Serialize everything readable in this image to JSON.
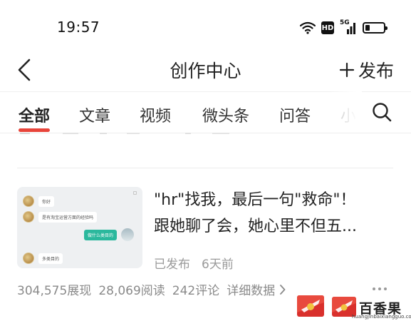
{
  "status_bar": {
    "time": "19:57",
    "network_label": "5G",
    "hd_label": "HD",
    "battery_level": 0.25
  },
  "nav": {
    "title": "创作中心",
    "publish_label": "发布",
    "back_icon": "chevron-left-icon",
    "publish_icon": "plus-icon"
  },
  "tabs": [
    {
      "label": "全部",
      "active": true
    },
    {
      "label": "文章",
      "active": false
    },
    {
      "label": "视频",
      "active": false
    },
    {
      "label": "微头条",
      "active": false
    },
    {
      "label": "问答",
      "active": false
    },
    {
      "label": "小",
      "active": false
    }
  ],
  "accent_color": "#e8443a",
  "article": {
    "title_line1": "\"hr\"找我，最后一句\"救命\"！",
    "title_line2": "跟她聊了会，她心里不但五...",
    "status": "已发布",
    "time": "6天前",
    "thumbnail": {
      "msg1": "你好",
      "msg2": "是有淘宝运营方面的经验吗",
      "msg3": "做什么类目的",
      "msg4": "多类目的"
    },
    "stats": {
      "views": "304,575展现",
      "reads": "28,069阅读",
      "comments": "242评论",
      "detail_label": "详细数据"
    }
  },
  "watermark": {
    "text": "百香果号",
    "url": "huangjinbaixiangguo.com"
  }
}
